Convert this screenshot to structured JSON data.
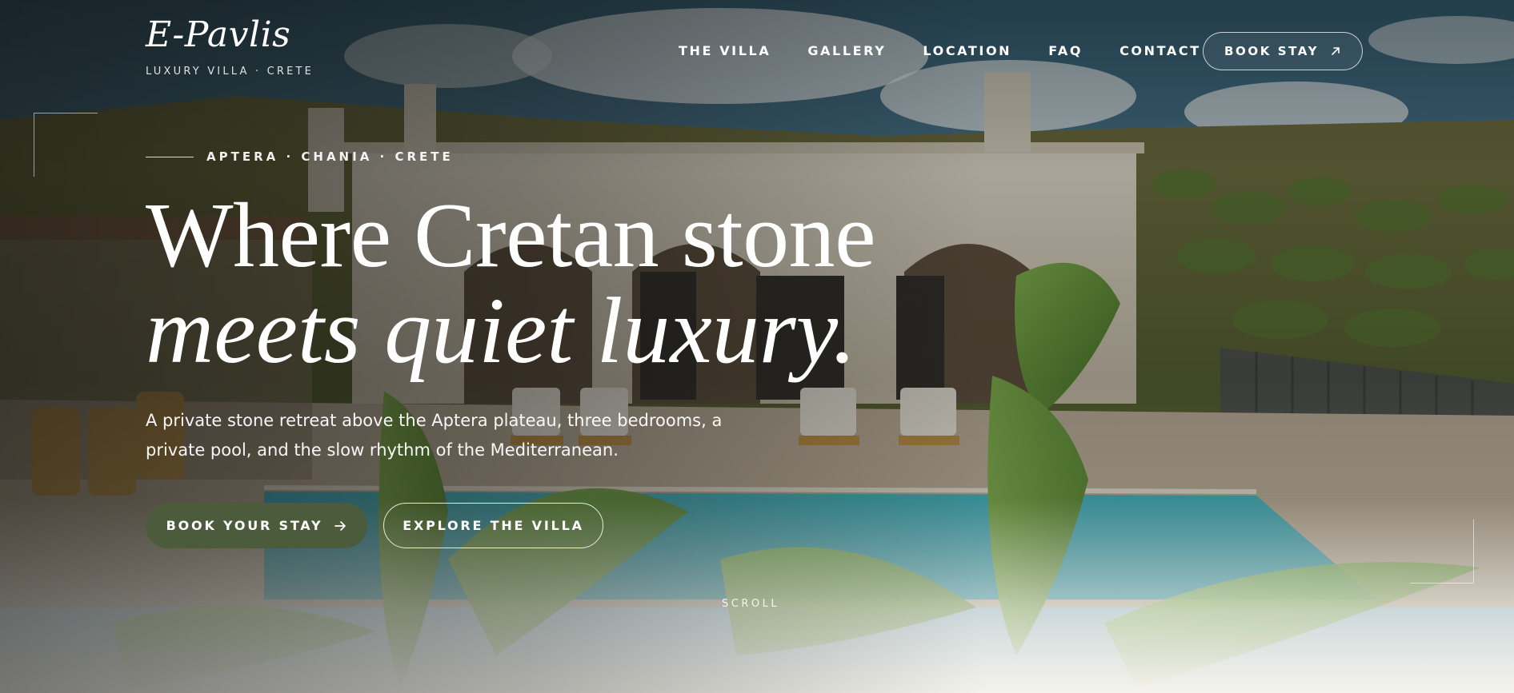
{
  "brand": {
    "name": "E-Pavlis",
    "tagline": "LUXURY VILLA · CRETE"
  },
  "nav": {
    "items": [
      "THE VILLA",
      "GALLERY",
      "LOCATION",
      "FAQ",
      "CONTACT"
    ],
    "book_label": "BOOK STAY"
  },
  "hero": {
    "eyebrow": "APTERA · CHANIA · CRETE",
    "headline_line1": "Where Cretan stone",
    "headline_line2": "meets quiet luxury.",
    "lede": "A private stone retreat above the Aptera plateau, three bedrooms, a private pool, and the slow rhythm of the Mediterranean.",
    "cta_primary": "BOOK YOUR STAY",
    "cta_secondary": "EXPLORE THE VILLA",
    "scroll_label": "SCROLL"
  },
  "colors": {
    "primary_cta": "#4b5b3c",
    "page_background": "#f4f2ec"
  },
  "icons": {
    "book_stay": "arrow-up-right-icon",
    "book_your_stay": "arrow-right-icon"
  }
}
